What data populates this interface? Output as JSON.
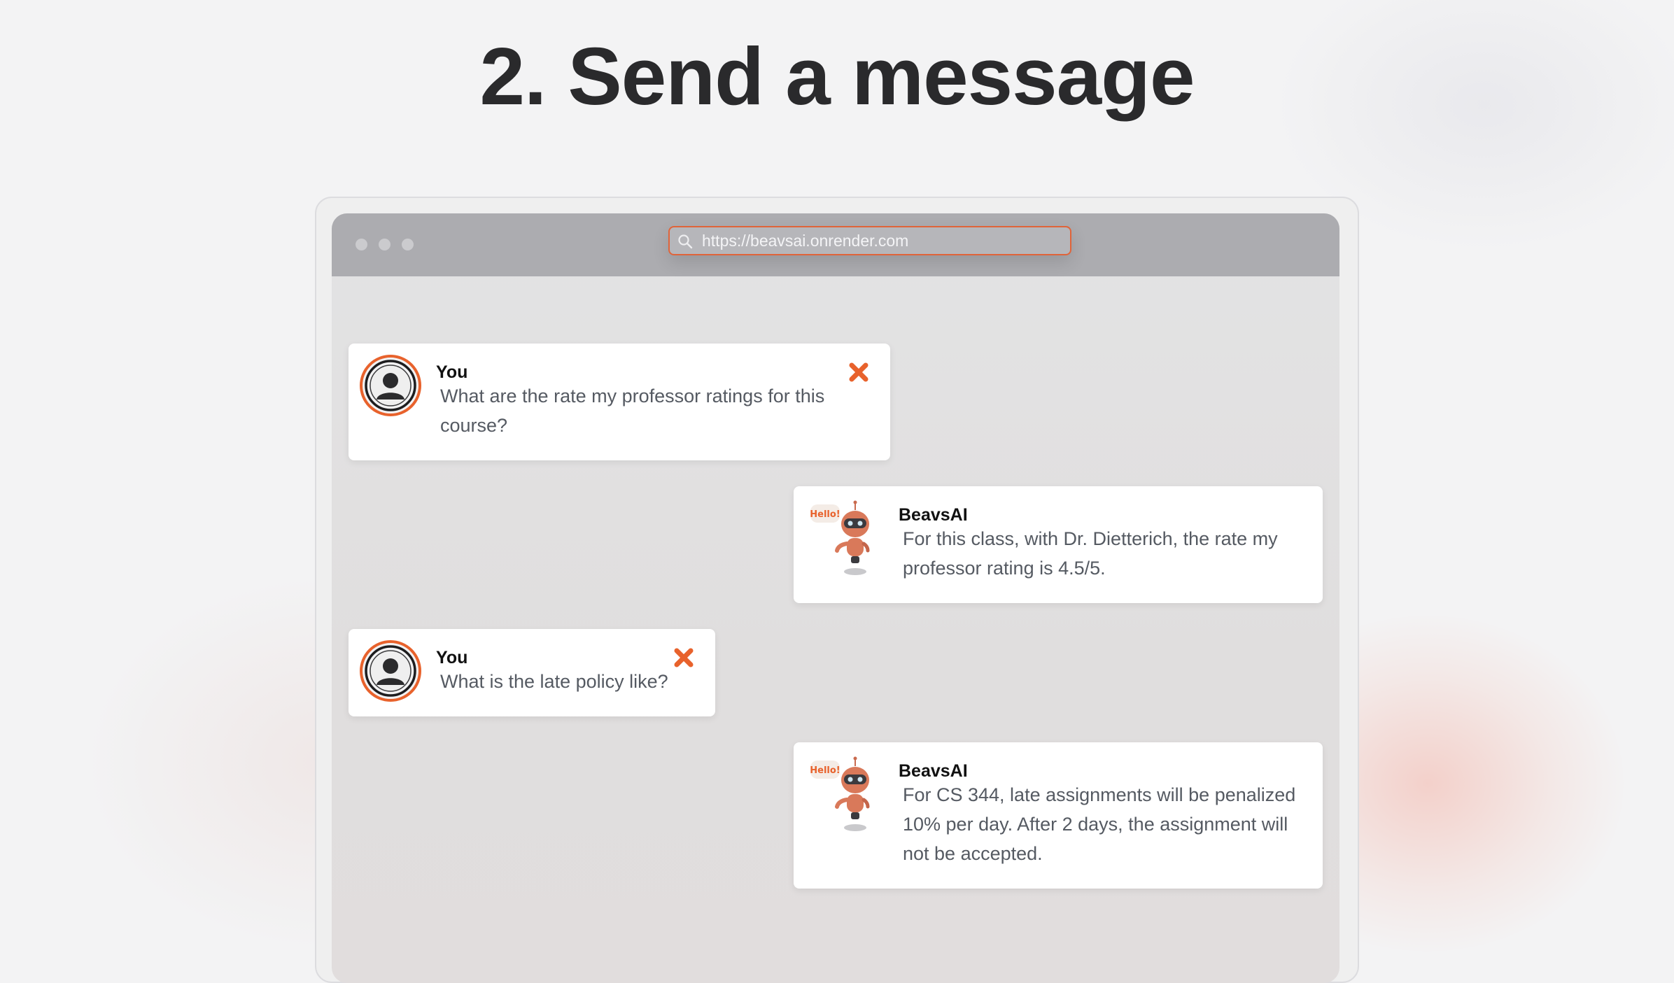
{
  "page": {
    "title": "2. Send a message"
  },
  "browser": {
    "url": "https://beavsai.onrender.com"
  },
  "messages": [
    {
      "sender": "You",
      "text": "What are the rate my professor ratings for this course?"
    },
    {
      "sender": "BeavsAI",
      "text": "For this class, with Dr. Dietterich, the rate my professor rating is 4.5/5.",
      "badge": "Hello!"
    },
    {
      "sender": "You",
      "text": "What is the late policy like?"
    },
    {
      "sender": "BeavsAI",
      "text": "For CS 344, late assignments will be penalized 10% per day. After 2 days, the assignment will not be accepted.",
      "badge": "Hello!"
    }
  ],
  "icons": {
    "user_avatar": "user-silhouette-icon",
    "bot_avatar": "robot-icon",
    "delete": "close-x-icon",
    "search": "search-icon"
  },
  "colors": {
    "accent": "#e8622c",
    "titlebar": "#acacb0",
    "heading": "#2a2a2c"
  }
}
